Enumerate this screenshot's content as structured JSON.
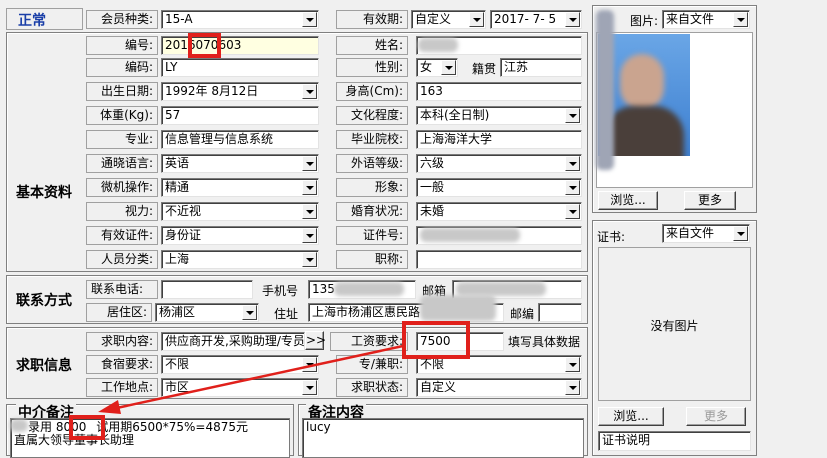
{
  "status": "正常",
  "sections": {
    "basic": "基本资料",
    "contact": "联系方式",
    "job": "求职信息",
    "agent": "中介备注",
    "remark": "备注内容"
  },
  "fields": {
    "member_type": {
      "label": "会员种类:",
      "value": "15-A"
    },
    "validity": {
      "label": "有效期:",
      "mode": "自定义",
      "date": "2017- 7- 5"
    },
    "number": {
      "label": "编号:",
      "value": "2016070603"
    },
    "name": {
      "label": "姓名:",
      "value": ""
    },
    "code": {
      "label": "编码:",
      "value": "LY"
    },
    "gender": {
      "label": "性别:",
      "value": "女"
    },
    "origin": {
      "label": "籍贯",
      "value": "江苏"
    },
    "birth": {
      "label": "出生日期:",
      "value": "1992年 8月12日"
    },
    "height": {
      "label": "身高(Cm):",
      "value": "163"
    },
    "weight": {
      "label": "体重(Kg):",
      "value": "57"
    },
    "education": {
      "label": "文化程度:",
      "value": "本科(全日制)"
    },
    "major": {
      "label": "专业:",
      "value": "信息管理与信息系统"
    },
    "school": {
      "label": "毕业院校:",
      "value": "上海海洋大学"
    },
    "language": {
      "label": "通晓语言:",
      "value": "英语"
    },
    "foreign_level": {
      "label": "外语等级:",
      "value": "六级"
    },
    "computer": {
      "label": "微机操作:",
      "value": "精通"
    },
    "image": {
      "label": "形象:",
      "value": "一般"
    },
    "vision": {
      "label": "视力:",
      "value": "不近视"
    },
    "marital": {
      "label": "婚育状况:",
      "value": "未婚"
    },
    "id_type": {
      "label": "有效证件:",
      "value": "身份证"
    },
    "id_no": {
      "label": "证件号:",
      "value": ""
    },
    "category": {
      "label": "人员分类:",
      "value": "上海"
    },
    "title": {
      "label": "职称:",
      "value": ""
    },
    "phone": {
      "label": "联系电话:",
      "value": ""
    },
    "mobile": {
      "label": "手机号",
      "value": "135"
    },
    "email": {
      "label": "邮箱",
      "value": ""
    },
    "district": {
      "label": "居住区:",
      "value": "杨浦区"
    },
    "address": {
      "label": "住址",
      "value": "上海市杨浦区惠民路"
    },
    "postcode": {
      "label": "邮编",
      "value": ""
    },
    "job_content": {
      "label": "求职内容:",
      "value": "供应商开发,采购助理/专员",
      "button": ">>"
    },
    "salary": {
      "label": "工资要求:",
      "value": "7500",
      "hint": "填写具体数据"
    },
    "board": {
      "label": "食宿要求:",
      "value": "不限"
    },
    "fulltime": {
      "label": "专/兼职:",
      "value": "不限"
    },
    "workplace": {
      "label": "工作地点:",
      "value": "市区"
    },
    "job_status": {
      "label": "求职状态:",
      "value": "自定义"
    }
  },
  "agent_note": {
    "line1_prefix": "录用",
    "line1_amount": "8000",
    "line1_rest": "试用期6500*75%=4875元",
    "line2": "直属大领导董事长助理"
  },
  "remark_note": "lucy",
  "photo": {
    "label": "图片:",
    "source": "来自文件",
    "browse": "浏览...",
    "more": "更多"
  },
  "cert": {
    "label": "证书:",
    "source": "来自文件",
    "empty": "没有图片",
    "browse": "浏览...",
    "more": "更多",
    "desc": "证书说明"
  }
}
